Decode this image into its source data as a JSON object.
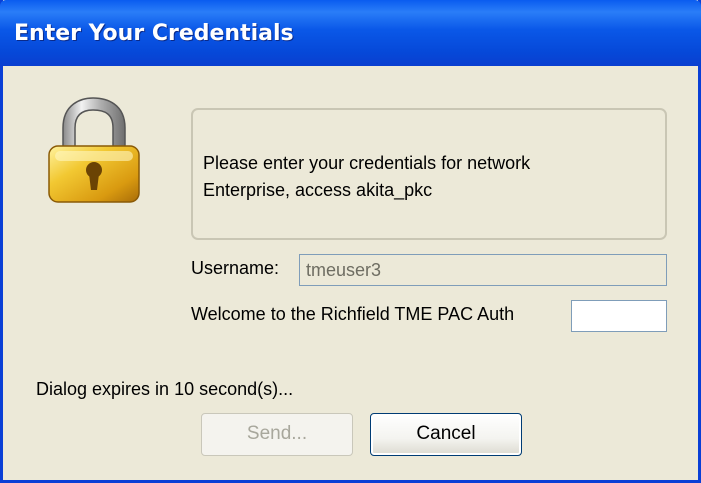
{
  "window": {
    "title": "Enter Your Credentials"
  },
  "icon": {
    "name": "padlock-icon"
  },
  "message": {
    "line1": "Please enter your credentials for network",
    "line2": "Enterprise, access akita_pkc"
  },
  "form": {
    "username_label": "Username:",
    "username_value": "tmeuser3",
    "prompt_label": "Welcome to the Richfield TME PAC Auth",
    "prompt_value": ""
  },
  "status": {
    "expire_text": "Dialog expires in 10 second(s)..."
  },
  "buttons": {
    "send_label": "Send...",
    "cancel_label": "Cancel"
  },
  "colors": {
    "titlebar": "#0a58e8",
    "window_bg": "#ece9d8",
    "lock_gold": "#e8b820"
  }
}
